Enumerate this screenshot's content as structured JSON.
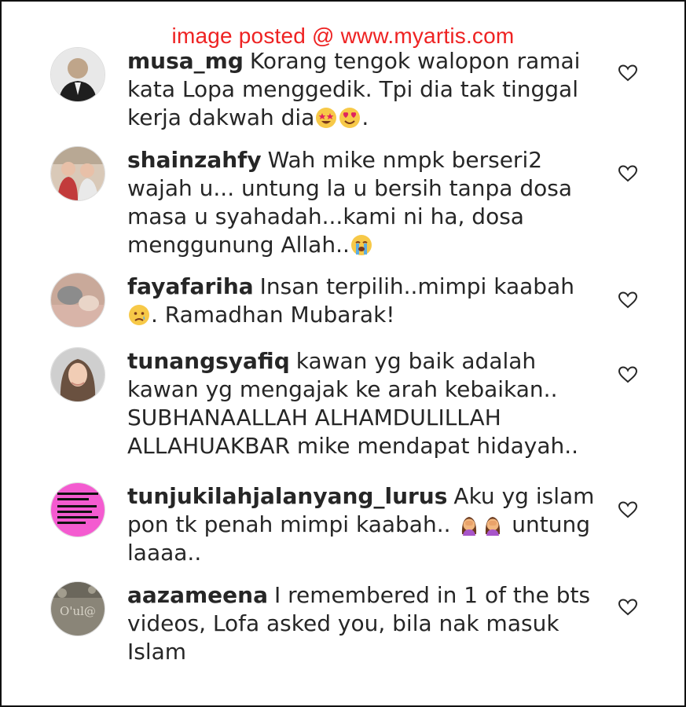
{
  "watermark": "image posted @ www.myartis.com",
  "comments": [
    {
      "username": "musa_mg",
      "text_parts": [
        "Korang tengok walopon ramai kata Lopa menggedik. Tpi dia tak tinggal kerja dakwah dia",
        "."
      ],
      "emojis": [
        "star-struck-emoji",
        "heart-eyes-emoji"
      ]
    },
    {
      "username": "shainzahfy",
      "text_parts": [
        "Wah mike nmpk berseri2 wajah u... untung la u bersih tanpa dosa masa u syahadah...kami ni ha, dosa menggunung Allah..",
        ""
      ],
      "emojis": [
        "loudly-crying-emoji"
      ]
    },
    {
      "username": "fayafariha",
      "text_parts": [
        "Insan terpilih..mimpi kaabah ",
        ". Ramadhan Mubarak!"
      ],
      "emojis": [
        "sad-tear-emoji"
      ]
    },
    {
      "username": "tunangsyafiq",
      "text_parts": [
        "kawan yg baik adalah kawan yg mengajak ke arah kebaikan.. SUBHANAALLAH ALHAMDULILLAH ALLAHUAKBAR mike mendapat hidayah..",
        ""
      ],
      "emojis": []
    },
    {
      "username": "tunjukilahjalanyang_lurus",
      "text_parts": [
        "Aku yg islam pon tk penah mimpi kaabah.. ",
        " untung laaaa.."
      ],
      "emojis": [
        "facepalm-woman-emoji",
        "facepalm-woman-emoji"
      ]
    },
    {
      "username": "aazameena",
      "text_parts": [
        "I remembered in 1 of the bts videos, Lofa asked you, bila nak masuk Islam",
        ""
      ],
      "emojis": []
    }
  ]
}
